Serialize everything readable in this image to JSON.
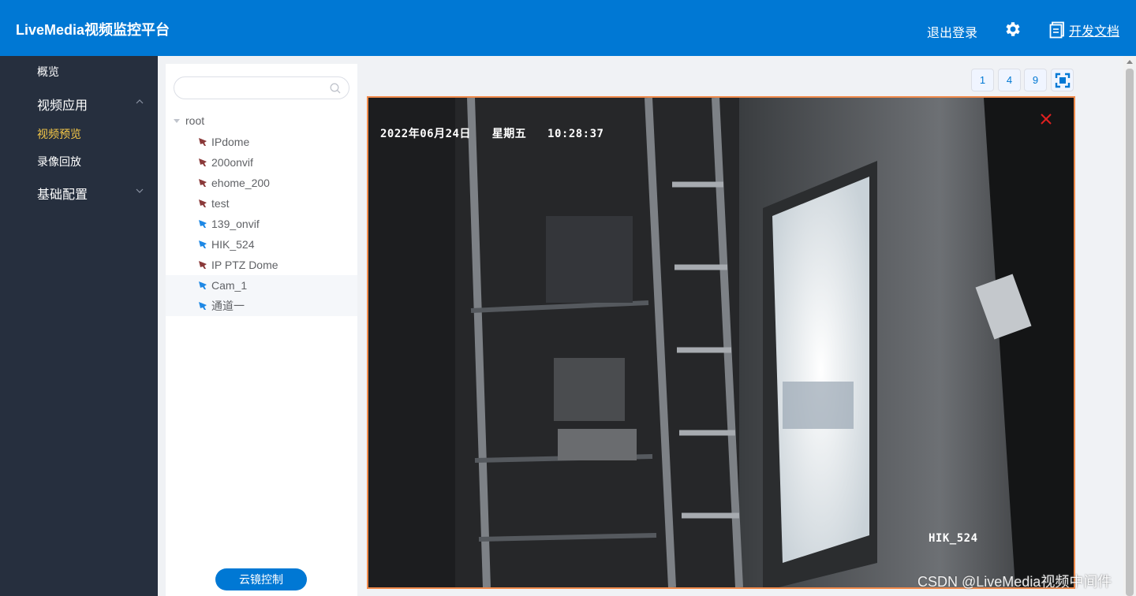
{
  "header": {
    "brand": "LiveMedia视频监控平台",
    "logout": "退出登录",
    "docs": "开发文档"
  },
  "sidebar": {
    "overview": "概览",
    "video_app": "视频应用",
    "preview": "视频预览",
    "playback": "录像回放",
    "base_config": "基础配置"
  },
  "tree": {
    "search_placeholder": "",
    "root": "root",
    "nodes": [
      {
        "label": "IPdome",
        "online": false
      },
      {
        "label": "200onvif",
        "online": false
      },
      {
        "label": "ehome_200",
        "online": false
      },
      {
        "label": "test",
        "online": false
      },
      {
        "label": "139_onvif",
        "online": true
      },
      {
        "label": "HIK_524",
        "online": true
      },
      {
        "label": "IP PTZ Dome",
        "online": false
      },
      {
        "label": "Cam_1",
        "online": true
      },
      {
        "label": "通道一",
        "online": true
      }
    ],
    "ptz_button": "云镜控制"
  },
  "layout_buttons": [
    "1",
    "4",
    "9"
  ],
  "video": {
    "timestamp_date": "2022年06月24日",
    "timestamp_day": "星期五",
    "timestamp_time": "10:28:37",
    "channel_name": "HIK_524"
  },
  "watermark": "CSDN @LiveMedia视频中间件",
  "colors": {
    "primary": "#0078d4",
    "sidebar": "#262f3e",
    "active_menu": "#f7c948",
    "video_border": "#f08a4b",
    "close": "#e02020",
    "camera_online": "#1e88e5",
    "camera_offline": "#8b3a3a"
  }
}
